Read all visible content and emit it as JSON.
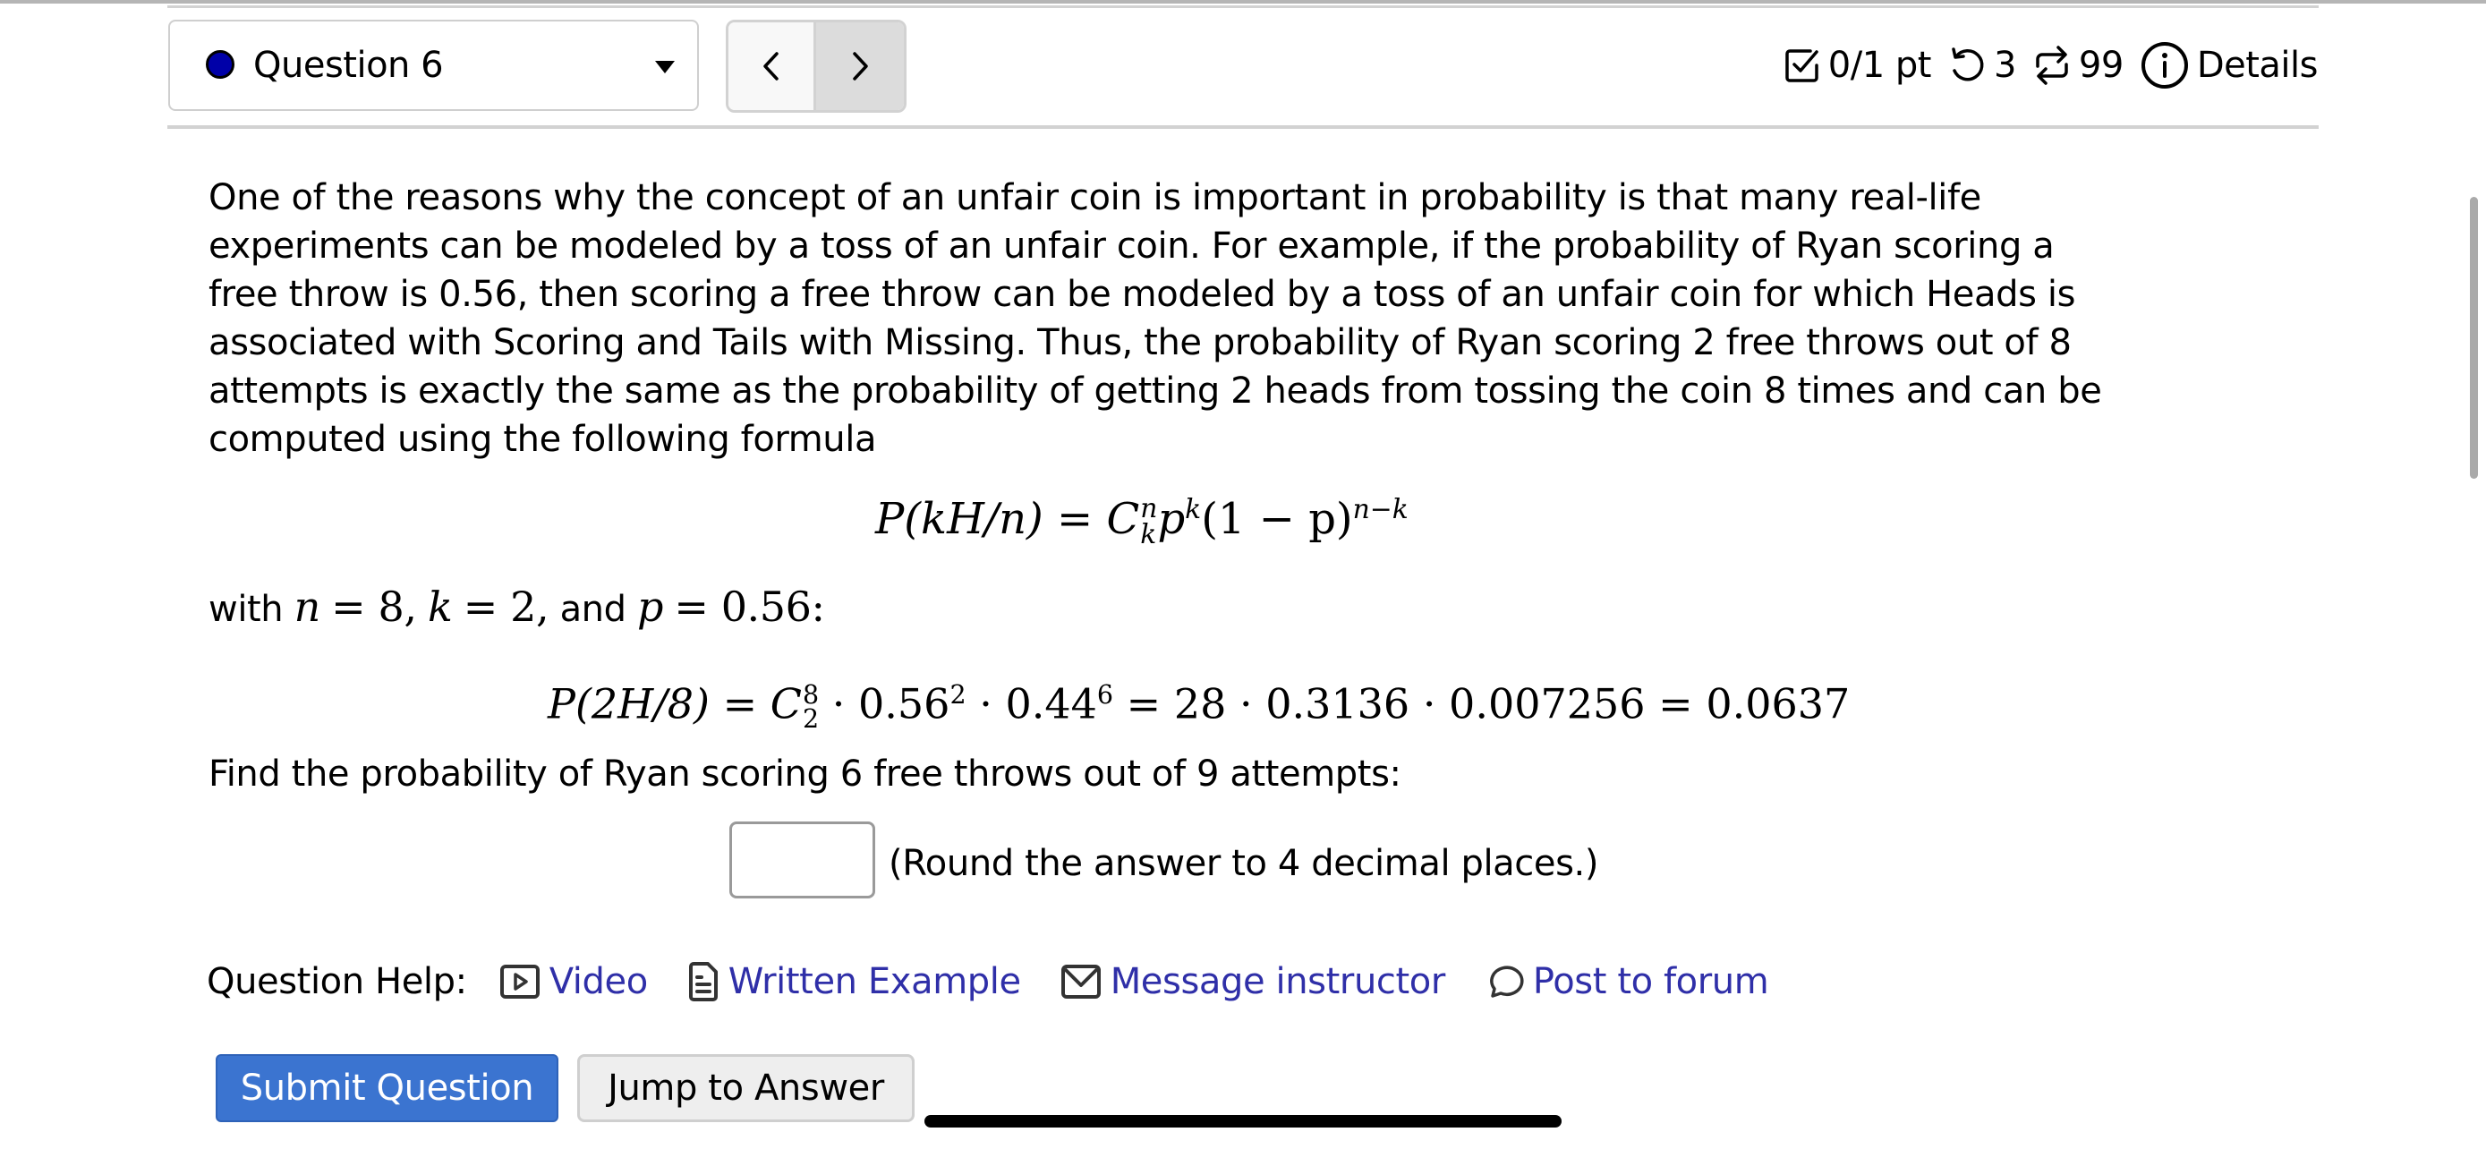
{
  "header": {
    "question_selector": {
      "label": "Question 6",
      "status_color": "#0000a8"
    },
    "nav": {
      "prev_icon": "chevron-left-icon",
      "next_icon": "chevron-right-icon"
    },
    "info": {
      "score": "0/1 pt",
      "retries": "3",
      "attempts": "99",
      "details_label": "Details"
    }
  },
  "question": {
    "intro": "One of the reasons why the concept of an unfair coin is important in probability is that many real-life experiments can be modeled by a toss of an unfair coin. For example, if the probability of Ryan scoring a free throw is 0.56, then scoring a free throw can be modeled by a toss of an unfair coin for which Heads is associated with Scoring and Tails with Missing. Thus, the probability of Ryan scoring 2 free throws out of 8 attempts is exactly the same as the probability of getting 2 heads from tossing the coin 8 times and can be computed using the following formula",
    "formula_general": {
      "lhs": "P(kH/n)",
      "eq": "=",
      "C": "C",
      "C_sup": "n",
      "C_sub": "k",
      "p": "p",
      "p_exp": "k",
      "paren": "(1 − p)",
      "paren_exp": "n−k"
    },
    "with_line": {
      "prefix": "with",
      "n_var": "n",
      "n_val": "= 8,",
      "k_var": "k",
      "k_val": "= 2,",
      "and": "and",
      "p_var": "p",
      "p_val": "= 0.56:"
    },
    "formula_example": {
      "lhs": "P(2H/8) =",
      "C": "C",
      "C_sup": "8",
      "C_sub": "2",
      "term1": "· 0.56",
      "term1_exp": "2",
      "term2": "· 0.44",
      "term2_exp": "6",
      "rest": "= 28 · 0.3136 · 0.007256 = 0.0637"
    },
    "prompt": "Find the probability of Ryan scoring 6 free throws out of 9 attempts:",
    "answer_value": "",
    "round_hint": "(Round the answer to 4 decimal places.)"
  },
  "help": {
    "label": "Question Help:",
    "links": [
      {
        "label": "Video",
        "icon": "video-icon"
      },
      {
        "label": "Written Example",
        "icon": "document-icon"
      },
      {
        "label": "Message instructor",
        "icon": "mail-icon"
      },
      {
        "label": "Post to forum",
        "icon": "chat-bubble-icon"
      }
    ]
  },
  "actions": {
    "submit_label": "Submit Question",
    "jump_label": "Jump to Answer"
  },
  "colors": {
    "link": "#2f2fa8",
    "submit": "#3b74d0"
  }
}
